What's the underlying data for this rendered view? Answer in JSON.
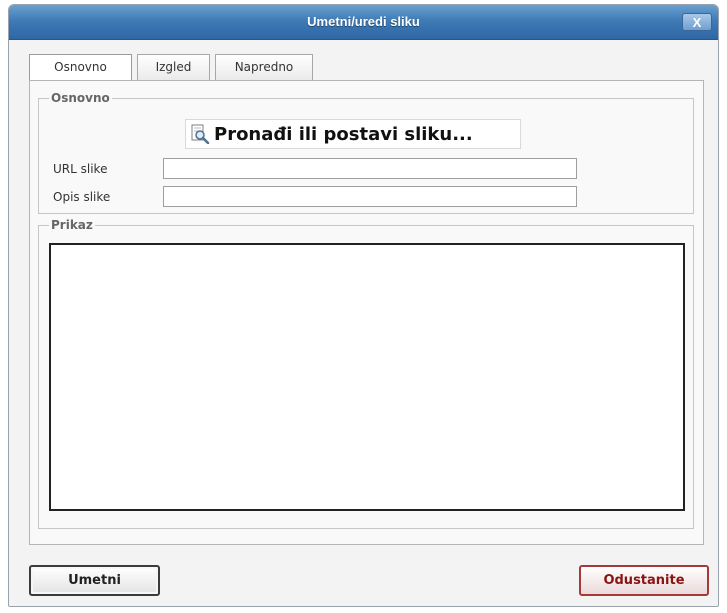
{
  "dialog": {
    "title": "Umetni/uredi sliku",
    "close_label": "X"
  },
  "tabs": [
    {
      "label": "Osnovno",
      "active": true
    },
    {
      "label": "Izgled",
      "active": false
    },
    {
      "label": "Napredno",
      "active": false
    }
  ],
  "basic_group": {
    "legend": "Osnovno",
    "browse_label": "Pronađi ili postavi sliku...",
    "browse_icon": "magnifier-page-icon",
    "url_label": "URL slike",
    "url_value": "",
    "description_label": "Opis slike",
    "description_value": ""
  },
  "preview_group": {
    "legend": "Prikaz"
  },
  "footer": {
    "insert_label": "Umetni",
    "cancel_label": "Odustanite"
  }
}
